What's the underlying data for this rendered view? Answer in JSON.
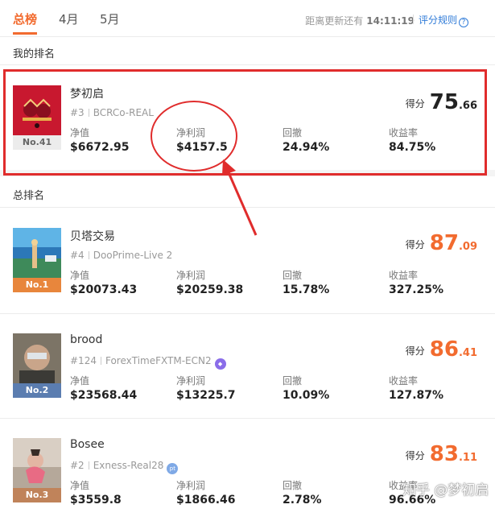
{
  "tabs": [
    {
      "label": "总榜",
      "active": true
    },
    {
      "label": "4月",
      "active": false
    },
    {
      "label": "5月",
      "active": false
    }
  ],
  "update": {
    "text": "距离更新还有",
    "time": "14:11:19"
  },
  "rules_label": "评分规则",
  "rules_icon_glyph": "?",
  "my_rank_title": "我的排名",
  "all_rank_title": "总排名",
  "stat_labels": {
    "equity": "净值",
    "profit": "净利润",
    "drawdown": "回撤",
    "return": "收益率"
  },
  "score_label": "得分",
  "my_entry": {
    "name": "梦初启",
    "rank_num": "#3",
    "account": "BCRCo-REAL",
    "badge": "No.41",
    "equity": "$6672.95",
    "profit": "$4157.5",
    "drawdown": "24.94%",
    "return": "84.75%",
    "score_int": "75",
    "score_dec": ".66"
  },
  "entries": [
    {
      "name": "贝塔交易",
      "rank_num": "#4",
      "account": "DooPrime-Live 2",
      "badge": "No.1",
      "equity": "$20073.43",
      "profit": "$20259.38",
      "drawdown": "15.78%",
      "return": "327.25%",
      "score_int": "87",
      "score_dec": ".09"
    },
    {
      "name": "brood",
      "rank_num": "#124",
      "account": "ForexTimeFXTM-ECN2",
      "badge": "No.2",
      "equity": "$23568.44",
      "profit": "$13225.7",
      "drawdown": "10.09%",
      "return": "127.87%",
      "score_int": "86",
      "score_dec": ".41"
    },
    {
      "name": "Bosee",
      "rank_num": "#2",
      "account": "Exness-Real28",
      "account_badge": "pt",
      "badge": "No.3",
      "equity": "$3559.8",
      "profit": "$1866.46",
      "drawdown": "2.78%",
      "return": "96.66%",
      "score_int": "83",
      "score_dec": ".11"
    }
  ],
  "watermark": "知乎 @梦初启",
  "colors": {
    "accent": "#f26b2f",
    "link": "#2f7bd8",
    "annotation": "#e02c2c",
    "gold": "#e8863c",
    "silver": "#5b7db0",
    "bronze": "#c0835a"
  }
}
